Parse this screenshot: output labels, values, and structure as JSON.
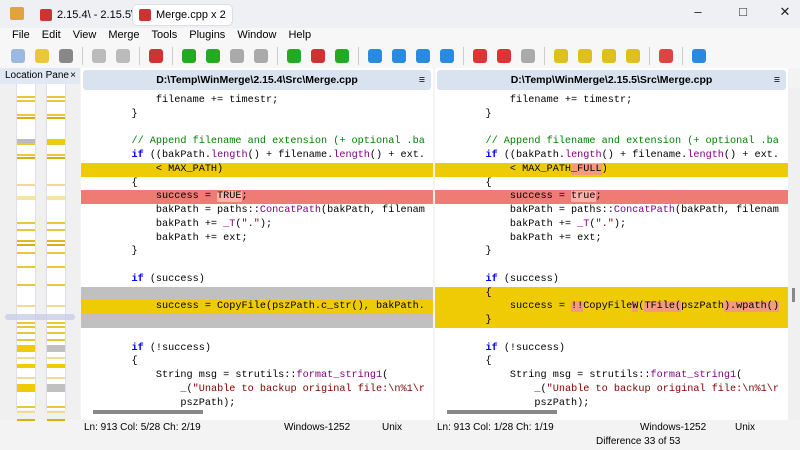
{
  "tabs": [
    {
      "label": "2.15.4\\ - 2.15.5\\"
    },
    {
      "label": "Merge.cpp x 2"
    }
  ],
  "menu": [
    "File",
    "Edit",
    "View",
    "Merge",
    "Tools",
    "Plugins",
    "Window",
    "Help"
  ],
  "toolbar_icons": [
    "new-document-icon",
    "open-folder-icon",
    "save-icon",
    "undo-icon",
    "redo-icon",
    "compare-icon",
    "copy-to-right-icon",
    "copy-to-left-icon",
    "copy-right-advance-icon",
    "copy-left-advance-icon",
    "first-diff-icon",
    "current-diff-icon",
    "last-diff-icon",
    "next-diff-icon",
    "prev-diff-icon",
    "next-conflict-icon",
    "prev-conflict-icon",
    "copy-all-right-icon",
    "copy-all-left-icon",
    "merge-icon",
    "first-file-icon",
    "prev-file-icon",
    "next-file-icon",
    "last-file-icon",
    "options-icon",
    "refresh-icon"
  ],
  "location_pane": {
    "title": "Location Pane",
    "close": "×"
  },
  "left": {
    "path": "D:\\Temp\\WinMerge\\2.15.4\\Src\\Merge.cpp",
    "status": {
      "pos": "Ln: 913  Col: 5/28  Ch: 2/19",
      "encoding": "Windows-1252",
      "eol": "Unix"
    },
    "lines": [
      {
        "c": "",
        "s": [
          [
            "        filename += timestr;",
            ""
          ]
        ]
      },
      {
        "c": "",
        "s": [
          [
            "    }",
            ""
          ]
        ]
      },
      {
        "c": "",
        "s": [
          [
            "",
            ""
          ]
        ]
      },
      {
        "c": "",
        "s": [
          [
            "    // Append filename and extension (+ optional .ba",
            "cm"
          ]
        ]
      },
      {
        "c": "",
        "s": [
          [
            "    ",
            ""
          ],
          [
            "if",
            "kw"
          ],
          [
            " ((bakPath.",
            ""
          ],
          [
            "length",
            "fn"
          ],
          [
            "() + filename.",
            ""
          ],
          [
            "length",
            "fn"
          ],
          [
            "() + ext.",
            ""
          ]
        ]
      },
      {
        "c": "y",
        "s": [
          [
            "        < MAX_PATH)",
            ""
          ]
        ]
      },
      {
        "c": "",
        "s": [
          [
            "    {",
            ""
          ]
        ]
      },
      {
        "c": "r",
        "s": [
          [
            "        success = ",
            ""
          ],
          [
            "TRUE",
            "hr"
          ],
          [
            ";",
            ""
          ]
        ]
      },
      {
        "c": "",
        "s": [
          [
            "        bakPath = paths::",
            ""
          ],
          [
            "ConcatPath",
            "fn"
          ],
          [
            "(bakPath, filenam",
            ""
          ]
        ]
      },
      {
        "c": "",
        "s": [
          [
            "        bakPath += ",
            ""
          ],
          [
            "_T",
            "fn"
          ],
          [
            "(",
            ""
          ],
          [
            "\".\"",
            "st"
          ],
          [
            ");",
            ""
          ]
        ]
      },
      {
        "c": "",
        "s": [
          [
            "        bakPath += ext;",
            ""
          ]
        ]
      },
      {
        "c": "",
        "s": [
          [
            "    }",
            ""
          ]
        ]
      },
      {
        "c": "",
        "s": [
          [
            "",
            ""
          ]
        ]
      },
      {
        "c": "",
        "s": [
          [
            "    ",
            ""
          ],
          [
            "if",
            "kw"
          ],
          [
            " (success)",
            ""
          ]
        ]
      },
      {
        "c": "g",
        "s": [
          [
            "",
            ""
          ]
        ]
      },
      {
        "c": "y",
        "s": [
          [
            "        success = CopyFile(pszPath.c_str(), bakPath.",
            ""
          ]
        ]
      },
      {
        "c": "g",
        "s": [
          [
            "",
            ""
          ]
        ]
      },
      {
        "c": "",
        "s": [
          [
            "",
            ""
          ]
        ]
      },
      {
        "c": "",
        "s": [
          [
            "    ",
            ""
          ],
          [
            "if",
            "kw"
          ],
          [
            " (!success)",
            ""
          ]
        ]
      },
      {
        "c": "",
        "s": [
          [
            "    {",
            ""
          ]
        ]
      },
      {
        "c": "",
        "s": [
          [
            "        String msg = strutils::",
            ""
          ],
          [
            "format_string1",
            "fn"
          ],
          [
            "(",
            ""
          ]
        ]
      },
      {
        "c": "",
        "s": [
          [
            "            ",
            ""
          ],
          [
            "_",
            "fn"
          ],
          [
            "(",
            ""
          ],
          [
            "\"Unable to backup original file:\\n%1\\r",
            "st"
          ]
        ]
      },
      {
        "c": "",
        "s": [
          [
            "            pszPath);",
            ""
          ]
        ]
      }
    ]
  },
  "right": {
    "path": "D:\\Temp\\WinMerge\\2.15.5\\Src\\Merge.cpp",
    "status": {
      "pos": "Ln: 913  Col: 1/28  Ch: 1/19",
      "encoding": "Windows-1252",
      "eol": "Unix"
    },
    "lines": [
      {
        "c": "",
        "s": [
          [
            "        filename += timestr;",
            ""
          ]
        ]
      },
      {
        "c": "",
        "s": [
          [
            "    }",
            ""
          ]
        ]
      },
      {
        "c": "",
        "s": [
          [
            "",
            ""
          ]
        ]
      },
      {
        "c": "",
        "s": [
          [
            "    // Append filename and extension (+ optional .ba",
            "cm"
          ]
        ]
      },
      {
        "c": "",
        "s": [
          [
            "    ",
            ""
          ],
          [
            "if",
            "kw"
          ],
          [
            " ((bakPath.",
            ""
          ],
          [
            "length",
            "fn"
          ],
          [
            "() + filename.",
            ""
          ],
          [
            "length",
            "fn"
          ],
          [
            "() + ext.",
            ""
          ]
        ]
      },
      {
        "c": "y",
        "s": [
          [
            "        < MAX_PATH",
            ""
          ],
          [
            "_FULL",
            "hl"
          ],
          [
            ")",
            ""
          ]
        ]
      },
      {
        "c": "",
        "s": [
          [
            "    {",
            ""
          ]
        ]
      },
      {
        "c": "r",
        "s": [
          [
            "        success = ",
            ""
          ],
          [
            "true",
            "hr"
          ],
          [
            ";",
            ""
          ]
        ]
      },
      {
        "c": "",
        "s": [
          [
            "        bakPath = paths::",
            ""
          ],
          [
            "ConcatPath",
            "fn"
          ],
          [
            "(bakPath, filenam",
            ""
          ]
        ]
      },
      {
        "c": "",
        "s": [
          [
            "        bakPath += ",
            ""
          ],
          [
            "_T",
            "fn"
          ],
          [
            "(",
            ""
          ],
          [
            "\".\"",
            "st"
          ],
          [
            ");",
            ""
          ]
        ]
      },
      {
        "c": "",
        "s": [
          [
            "        bakPath += ext;",
            ""
          ]
        ]
      },
      {
        "c": "",
        "s": [
          [
            "    }",
            ""
          ]
        ]
      },
      {
        "c": "",
        "s": [
          [
            "",
            ""
          ]
        ]
      },
      {
        "c": "",
        "s": [
          [
            "    ",
            ""
          ],
          [
            "if",
            "kw"
          ],
          [
            " (success)",
            ""
          ]
        ]
      },
      {
        "c": "y",
        "s": [
          [
            "    {",
            ""
          ]
        ]
      },
      {
        "c": "y",
        "s": [
          [
            "        success = ",
            ""
          ],
          [
            "!!",
            "hl"
          ],
          [
            "CopyFile",
            ""
          ],
          [
            "W",
            "hl"
          ],
          [
            "(",
            ""
          ],
          [
            "TFile(",
            "hl"
          ],
          [
            "pszPath",
            ""
          ],
          [
            ").wpath()",
            "hl"
          ]
        ]
      },
      {
        "c": "y",
        "s": [
          [
            "    }",
            ""
          ]
        ]
      },
      {
        "c": "",
        "s": [
          [
            "",
            ""
          ]
        ]
      },
      {
        "c": "",
        "s": [
          [
            "    ",
            ""
          ],
          [
            "if",
            "kw"
          ],
          [
            " (!success)",
            ""
          ]
        ]
      },
      {
        "c": "",
        "s": [
          [
            "    {",
            ""
          ]
        ]
      },
      {
        "c": "",
        "s": [
          [
            "        String msg = strutils::",
            ""
          ],
          [
            "format_string1",
            "fn"
          ],
          [
            "(",
            ""
          ]
        ]
      },
      {
        "c": "",
        "s": [
          [
            "            ",
            ""
          ],
          [
            "_",
            "fn"
          ],
          [
            "(",
            ""
          ],
          [
            "\"Unable to backup original file:\\n%1\\r",
            "st"
          ]
        ]
      },
      {
        "c": "",
        "s": [
          [
            "            pszPath);",
            ""
          ]
        ]
      }
    ]
  },
  "difference": "Difference 33 of 53"
}
